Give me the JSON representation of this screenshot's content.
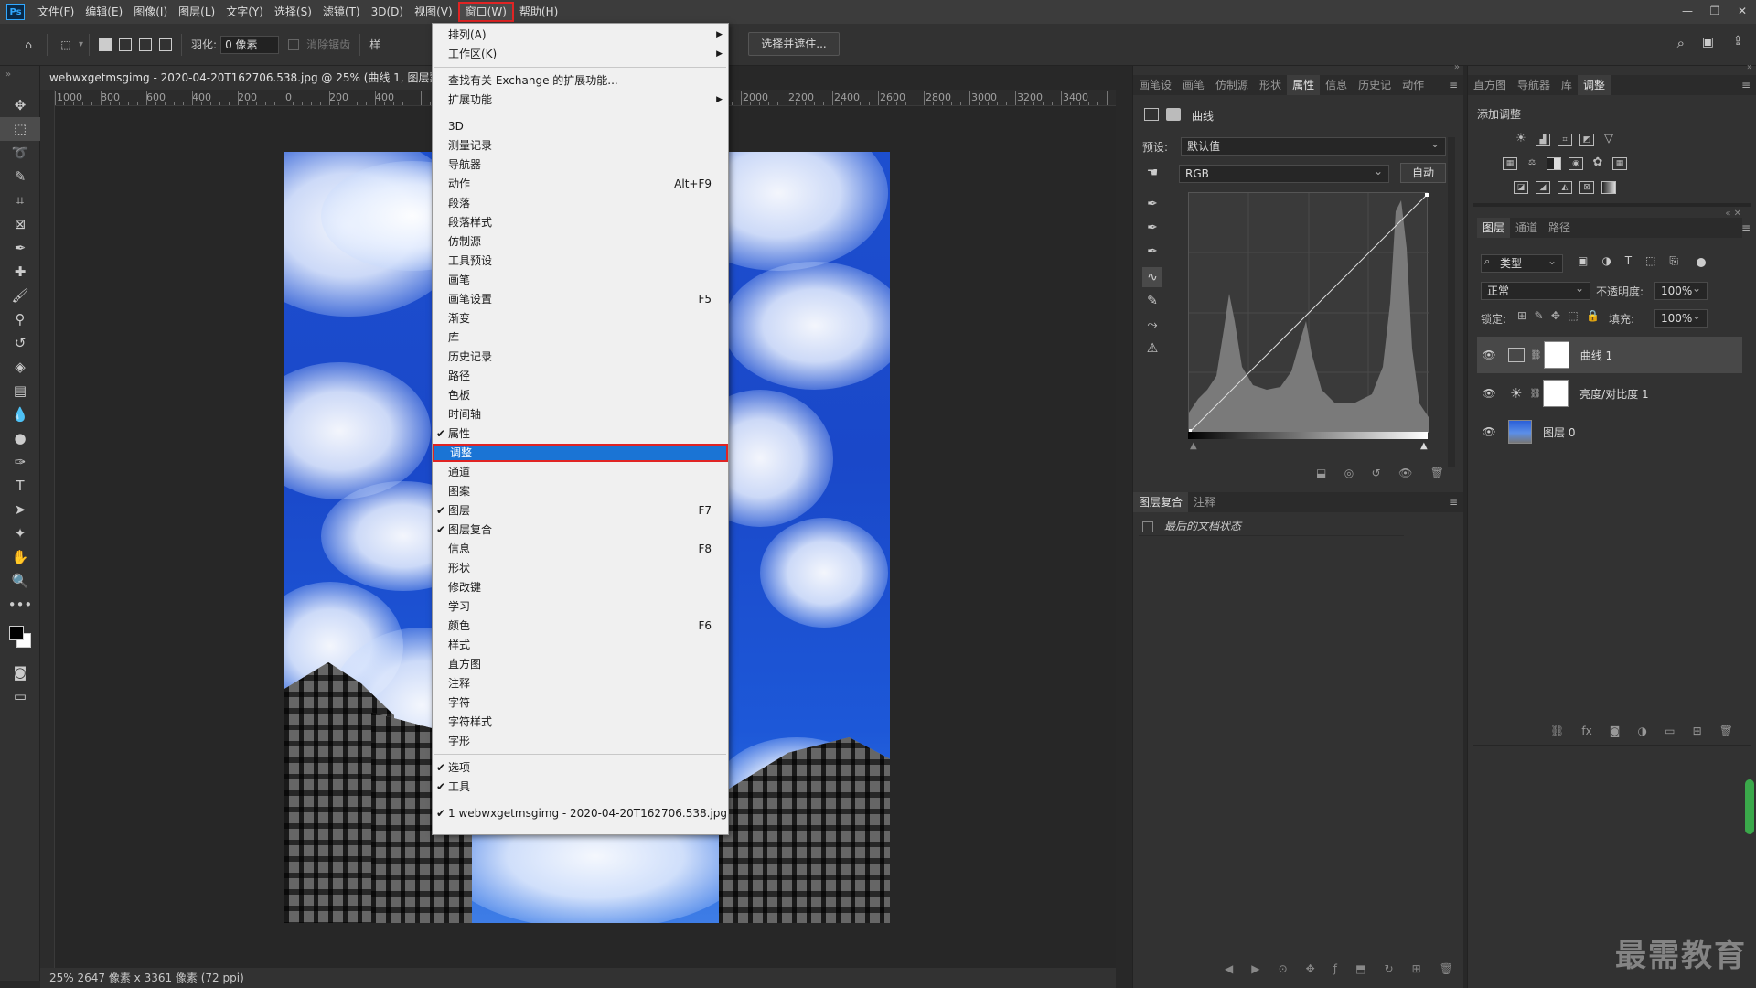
{
  "app": {
    "logo": "Ps",
    "menus": [
      "文件(F)",
      "编辑(E)",
      "图像(I)",
      "图层(L)",
      "文字(Y)",
      "选择(S)",
      "滤镜(T)",
      "3D(D)",
      "视图(V)",
      "窗口(W)",
      "帮助(H)"
    ],
    "active_menu": "窗口(W)"
  },
  "options_bar": {
    "feather_label": "羽化:",
    "feather_value": "0 像素",
    "antialias_label": "消除锯齿",
    "style_label": "样",
    "select_mask_button": "选择并遮住..."
  },
  "document": {
    "tab_title": "webwxgetmsgimg - 2020-04-20T162706.538.jpg @ 25% (曲线 1, 图层蒙",
    "ruler_labels": [
      "1000",
      "800",
      "600",
      "400",
      "200",
      "0",
      "200",
      "400",
      "2000",
      "2200",
      "2400",
      "2600",
      "2800",
      "3000",
      "3200",
      "3400"
    ],
    "status": "25%    2647 像素 x 3361 像素 (72 ppi)"
  },
  "window_menu": {
    "items": [
      {
        "label": "排列(A)",
        "submenu": true
      },
      {
        "label": "工作区(K)",
        "submenu": true
      },
      {
        "sep": true
      },
      {
        "label": "查找有关 Exchange 的扩展功能..."
      },
      {
        "label": "扩展功能",
        "submenu": true
      },
      {
        "sep": true
      },
      {
        "label": "3D"
      },
      {
        "label": "测量记录"
      },
      {
        "label": "导航器"
      },
      {
        "label": "动作",
        "shortcut": "Alt+F9"
      },
      {
        "label": "段落"
      },
      {
        "label": "段落样式"
      },
      {
        "label": "仿制源"
      },
      {
        "label": "工具预设"
      },
      {
        "label": "画笔"
      },
      {
        "label": "画笔设置",
        "shortcut": "F5"
      },
      {
        "label": "渐变"
      },
      {
        "label": "库"
      },
      {
        "label": "历史记录"
      },
      {
        "label": "路径"
      },
      {
        "label": "色板"
      },
      {
        "label": "时间轴"
      },
      {
        "label": "属性",
        "checked": true
      },
      {
        "label": "调整",
        "highlighted": true
      },
      {
        "label": "通道"
      },
      {
        "label": "图案"
      },
      {
        "label": "图层",
        "checked": true,
        "shortcut": "F7"
      },
      {
        "label": "图层复合",
        "checked": true
      },
      {
        "label": "信息",
        "shortcut": "F8"
      },
      {
        "label": "形状"
      },
      {
        "label": "修改键"
      },
      {
        "label": "学习"
      },
      {
        "label": "颜色",
        "shortcut": "F6"
      },
      {
        "label": "样式"
      },
      {
        "label": "直方图"
      },
      {
        "label": "注释"
      },
      {
        "label": "字符"
      },
      {
        "label": "字符样式"
      },
      {
        "label": "字形"
      },
      {
        "sep": true
      },
      {
        "label": "选项",
        "checked": true
      },
      {
        "label": "工具",
        "checked": true
      },
      {
        "sep": true
      },
      {
        "label": "1 webwxgetmsgimg - 2020-04-20T162706.538.jpg",
        "checked": true
      }
    ]
  },
  "properties_panel": {
    "tabs": [
      "画笔设",
      "画笔",
      "仿制源",
      "形状",
      "属性",
      "信息",
      "历史记",
      "动作"
    ],
    "active_tab": "属性",
    "title": "曲线",
    "preset_label": "预设:",
    "preset_value": "默认值",
    "channel_value": "RGB",
    "auto_button": "自动"
  },
  "layer_comps_panel": {
    "tabs": [
      "图层复合",
      "注释"
    ],
    "active_tab": "图层复合",
    "item": "最后的文档状态"
  },
  "right_top_panel": {
    "tabs": [
      "直方图",
      "导航器",
      "库",
      "调整"
    ],
    "active_tab": "调整",
    "add_adjustment_label": "添加调整"
  },
  "layers_panel": {
    "tabs": [
      "图层",
      "通道",
      "路径"
    ],
    "active_tab": "图层",
    "filter_label": "类型",
    "blend_mode": "正常",
    "opacity_label": "不透明度:",
    "opacity_value": "100%",
    "lock_label": "锁定:",
    "fill_label": "填充:",
    "fill_value": "100%",
    "layers": [
      {
        "name": "曲线 1",
        "selected": true
      },
      {
        "name": "亮度/对比度 1"
      },
      {
        "name": "图层 0"
      }
    ]
  },
  "watermark": "最需教育"
}
